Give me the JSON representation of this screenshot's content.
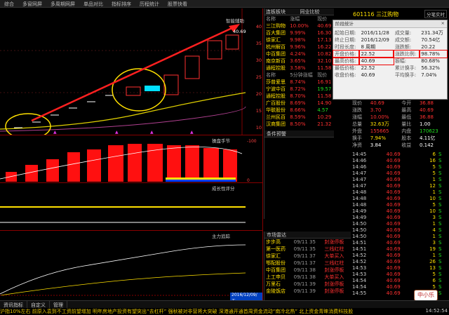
{
  "menu": [
    "综合",
    "多窗网屏",
    "多周期网屏",
    "单品对比",
    "指标排序",
    "历程统计",
    "股票快看"
  ],
  "main_chart": {
    "tag": "智能辅助",
    "high_mark": "40.69",
    "date_label": "2016/12/09/五",
    "y_ticks": [
      "40",
      "35",
      "30",
      "25",
      "20",
      "15",
      "10"
    ]
  },
  "sub_panels": [
    {
      "title": "操盘手节"
    },
    {
      "title": "成长性评分"
    },
    {
      "title": "主力追踪"
    }
  ],
  "stock_list": {
    "tabs": [
      "连板板块",
      "同业比较"
    ],
    "header": [
      "名称",
      "涨幅",
      "现价"
    ],
    "rows": [
      {
        "name": "三江购物",
        "pct": "10.00%",
        "price": "40.69"
      },
      {
        "name": "百大集团",
        "pct": "9.99%",
        "price": "16.30"
      },
      {
        "name": "徐家汇",
        "pct": "9.98%",
        "price": "17.13"
      },
      {
        "name": "杭州解百",
        "pct": "9.96%",
        "price": "16.22"
      },
      {
        "name": "中百集团",
        "pct": "4.24%",
        "price": "10.82"
      },
      {
        "name": "南京新百",
        "pct": "3.65%",
        "price": "32.10"
      },
      {
        "name": "通程控股",
        "pct": "3.58%",
        "price": "11.58"
      }
    ],
    "second_header": [
      "名称",
      "5分钟涨幅",
      "现价"
    ],
    "rows2": [
      {
        "name": "莎普爱思",
        "pct": "8.74%",
        "price": "16.91"
      },
      {
        "name": "宁波中百",
        "pct": "8.72%",
        "price": "19.57"
      },
      {
        "name": "通程控股",
        "pct": "8.70%",
        "price": "11.58"
      },
      {
        "name": "广百股份",
        "pct": "8.69%",
        "price": "14.90"
      },
      {
        "name": "华联股份",
        "pct": "8.66%",
        "price": "4.57"
      },
      {
        "name": "兰州民百",
        "pct": "8.59%",
        "price": "10.29"
      },
      {
        "name": "汉商集团",
        "pct": "8.50%",
        "price": "21.32"
      }
    ],
    "conditions_title": "条件预警",
    "market_title": "市场雷达",
    "radar": [
      {
        "name": "步步高",
        "time": "09/11 35",
        "event": "封涨停板"
      },
      {
        "name": "第一医药",
        "time": "09/11 35",
        "event": "三线红柱"
      },
      {
        "name": "徐家汇",
        "time": "09/11 37",
        "event": "大单买入"
      },
      {
        "name": "鄂配股份",
        "time": "09/11 37",
        "event": "三线红柱"
      },
      {
        "name": "中百集团",
        "time": "09/11 38",
        "event": "封涨停板"
      },
      {
        "name": "上工申贝",
        "time": "09/11 38",
        "event": "大单买入"
      },
      {
        "name": "万里石",
        "time": "09/11 39",
        "event": "封涨停板"
      },
      {
        "name": "金陵饭店",
        "time": "09/11 39",
        "event": "封涨停板"
      }
    ]
  },
  "dialog": {
    "title": "阶段统计",
    "close": "×",
    "rows": [
      {
        "l1": "起始日期:",
        "v1": "2016/11/28",
        "l2": "成交量:",
        "v2": "231.34万"
      },
      {
        "l1": "终止日期:",
        "v1": "2016/12/09",
        "l2": "成交额:",
        "v2": "70.54亿"
      },
      {
        "l1": "时段长度:",
        "v1": "8  周期",
        "l2": "涨跌额:",
        "v2": "20.22"
      },
      {
        "l1": "开盘价格:",
        "v1": "22.52",
        "l2": "涨跌比例:",
        "v2": "98.78%"
      },
      {
        "l1": "最高价格:",
        "v1": "40.69",
        "l2": "振幅:",
        "v2": "80.68%"
      },
      {
        "l1": "最低价格:",
        "v1": "22.52",
        "l2": "累计换手:",
        "v2": "56.32%"
      },
      {
        "l1": "收盘价格:",
        "v1": "40.69",
        "l2": "平均换手:",
        "v2": "7.04%"
      }
    ]
  },
  "quote": {
    "code_name": "601116 三江购物",
    "mode_button": "分笔实时",
    "info": [
      {
        "k": "现价",
        "v": "40.69",
        "k2": "今开",
        "v2": "36.88"
      },
      {
        "k": "涨跌",
        "v": "3.70",
        "k2": "最高",
        "v2": "40.69"
      },
      {
        "k": "涨幅",
        "v": "10.00%",
        "k2": "最低",
        "v2": "36.88"
      },
      {
        "k": "总量",
        "v": "32.63万",
        "k2": "量比",
        "v2": "1.00"
      },
      {
        "k": "外盘",
        "v": "155665",
        "k2": "内盘",
        "v2": "170623"
      },
      {
        "k": "换手",
        "v": "7.94%",
        "k2": "股本",
        "v2": "4.11亿"
      },
      {
        "k": "净资",
        "v": "3.84",
        "k2": "收益",
        "v2": "0.142"
      }
    ],
    "trades": [
      {
        "t": "14:45",
        "p": "40.69",
        "v": "6",
        "s": "S"
      },
      {
        "t": "14:46",
        "p": "40.69",
        "v": "16",
        "s": "S"
      },
      {
        "t": "14:46",
        "p": "40.69",
        "v": "5",
        "s": "S"
      },
      {
        "t": "14:47",
        "p": "40.69",
        "v": "5",
        "s": "S"
      },
      {
        "t": "14:47",
        "p": "40.69",
        "v": "1",
        "s": "S"
      },
      {
        "t": "14:47",
        "p": "40.69",
        "v": "12",
        "s": "S"
      },
      {
        "t": "14:48",
        "p": "40.69",
        "v": "1",
        "s": "S"
      },
      {
        "t": "14:48",
        "p": "40.69",
        "v": "10",
        "s": "S"
      },
      {
        "t": "14:48",
        "p": "40.69",
        "v": "5",
        "s": "S"
      },
      {
        "t": "14:49",
        "p": "40.69",
        "v": "10",
        "s": "S"
      },
      {
        "t": "14:49",
        "p": "40.69",
        "v": "3",
        "s": "S"
      },
      {
        "t": "14:50",
        "p": "40.69",
        "v": "1",
        "s": "S"
      },
      {
        "t": "14:50",
        "p": "40.69",
        "v": "4",
        "s": "S"
      },
      {
        "t": "14:50",
        "p": "40.69",
        "v": "1",
        "s": "S"
      },
      {
        "t": "14:51",
        "p": "40.69",
        "v": "3",
        "s": "S"
      },
      {
        "t": "14:51",
        "p": "40.69",
        "v": "19",
        "s": "S"
      },
      {
        "t": "14:52",
        "p": "40.69",
        "v": "1",
        "s": "S"
      },
      {
        "t": "14:52",
        "p": "40.69",
        "v": "26",
        "s": "S"
      },
      {
        "t": "14:53",
        "p": "40.69",
        "v": "13",
        "s": "S"
      },
      {
        "t": "14:53",
        "p": "40.69",
        "v": "5",
        "s": "S"
      },
      {
        "t": "14:54",
        "p": "40.69",
        "v": "6",
        "s": "S"
      },
      {
        "t": "14:54",
        "p": "40.69",
        "v": "5",
        "s": "S"
      },
      {
        "t": "14:55",
        "p": "40.69",
        "v": "5",
        "s": "S"
      }
    ]
  },
  "bottom_tabs": [
    "资讯指标",
    "自定义",
    "管理"
  ],
  "ticker": "沪指10%左右  前原入袁到不工资前望增加     明年房地产投资有望突出“去杠杆”  强秋被对非营将大突破     深港通开通首周资金流动“南冷北热”  北上资金青睐消费科技股",
  "clock": "14:52:54",
  "seal_text": "中小乐"
}
